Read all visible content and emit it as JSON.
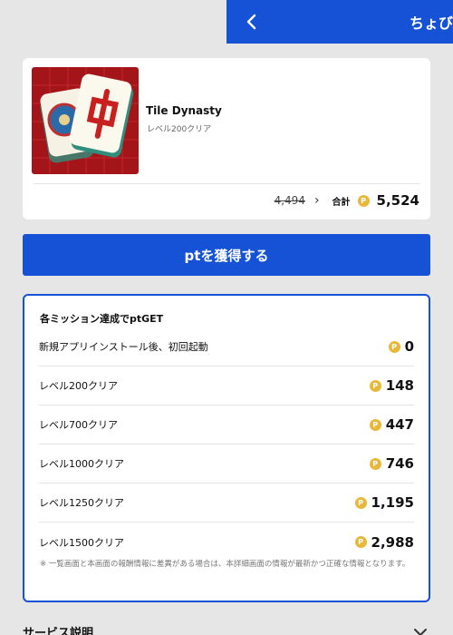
{
  "header": {
    "title": "ちょび",
    "back_icon": "chevron-left-icon"
  },
  "app": {
    "name": "Tile Dynasty",
    "subtitle": "レベル200クリア",
    "old_price": "4,494",
    "total_label": "合計",
    "total_value": "5,524",
    "coin_glyph": "P"
  },
  "cta": {
    "label": "ptを獲得する"
  },
  "missions": {
    "title": "各ミッション達成でptGET",
    "items": [
      {
        "label": "新規アプリインストール後、初回起動",
        "value": "0"
      },
      {
        "label": "レベル200クリア",
        "value": "148"
      },
      {
        "label": "レベル700クリア",
        "value": "447"
      },
      {
        "label": "レベル1000クリア",
        "value": "746"
      },
      {
        "label": "レベル1250クリア",
        "value": "1,195"
      },
      {
        "label": "レベル1500クリア",
        "value": "2,988"
      }
    ],
    "note": "※ 一覧画面と本画面の報酬情報に差異がある場合は、本詳細画面の情報が最新かつ正確な情報となります。"
  },
  "service": {
    "title": "サービス説明"
  },
  "colors": {
    "accent": "#1552d6",
    "coin": "#e9b839",
    "background": "#e6e6e6"
  }
}
